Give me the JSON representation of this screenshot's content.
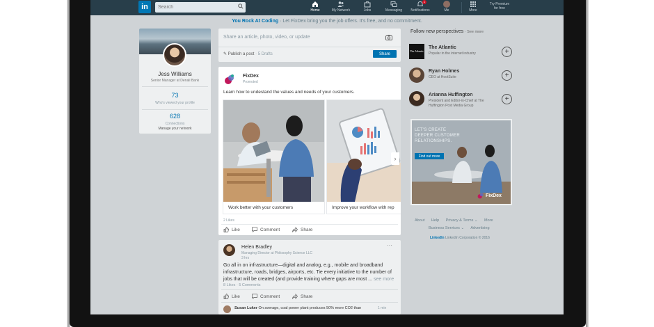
{
  "nav": {
    "logo": "in",
    "search_placeholder": "Search",
    "items": [
      {
        "label": "Home"
      },
      {
        "label": "My Network"
      },
      {
        "label": "Jobs"
      },
      {
        "label": "Messaging"
      },
      {
        "label": "Notifications",
        "badge": "1"
      },
      {
        "label": "Me"
      },
      {
        "label": "More"
      }
    ],
    "premium_line1": "Try Premium",
    "premium_line2": "for free"
  },
  "banner": {
    "link": "You Rock At Coding",
    "text": " · Let FixDex bring you the job offers. It's free, and no commitment."
  },
  "profile": {
    "name": "Jess Williams",
    "headline": "Senior Manager at Denali Bank",
    "views_count": "73",
    "views_label": "Who's viewed your profile",
    "connections_count": "628",
    "connections_label": "Connections",
    "manage_label": "Manage your network"
  },
  "share": {
    "placeholder": "Share an article, photo, video, or update",
    "publish": "Publish a post",
    "drafts": " · 5 Drafts",
    "button": "Share"
  },
  "ad": {
    "brand": "FixDex",
    "promoted": "Promoted",
    "copy": "Learn how to undestand the values and needs of your customers.",
    "slides": [
      {
        "caption": "Work better with your customers"
      },
      {
        "caption": "Improve your workflow with rep"
      }
    ],
    "likes": "2 Likes",
    "actions": {
      "like": "Like",
      "comment": "Comment",
      "share": "Share"
    }
  },
  "post": {
    "author": "Helen Bradley",
    "headline": "Managing Director at Philosophy Science LLC",
    "time": "3 hrs",
    "body": "Go all in on infrastructure—digital and analog, e.g., mobile and broadband infrastructure, roads, bridges, airports, etc. Tie every initiative to the number of jobs that will be created (and provide training where gaps are most ...",
    "see_more": "see more",
    "counts": "8 Likes · 5 Comments",
    "actions": {
      "like": "Like",
      "comment": "Comment",
      "share": "Share"
    },
    "comment_author": "Susan Luker",
    "comment_text": " On average, coal power plant produces 50% more CO2 than",
    "comment_time": "1 min"
  },
  "rail": {
    "title": "Follow new perspectives",
    "see_more": " · See more",
    "follows": [
      {
        "name": "The Atlantic",
        "desc": "Popular in the internet industry",
        "avatar_text": "The Atlantic"
      },
      {
        "name": "Ryan Holmes",
        "desc": "CEO at HootSuite"
      },
      {
        "name": "Arianna Huffington",
        "desc": "President and Editor-in-Chief at The Huffington Post Media Group"
      }
    ],
    "ad_line1": "LET'S CREATE",
    "ad_line2": "DEEPER CUSTOMER",
    "ad_line3": "RELATIONSHIPS.",
    "ad_cta": "Find out more",
    "ad_logo": "FixDex",
    "footer_row1": [
      "About",
      "Help",
      "Privacy & Terms ⌄",
      "More"
    ],
    "footer_row2": [
      "Business Services ⌄",
      "Advertising"
    ],
    "copyright_brand": "LinkedIn",
    "copyright": " LinkedIn Corporation © 2016"
  }
}
